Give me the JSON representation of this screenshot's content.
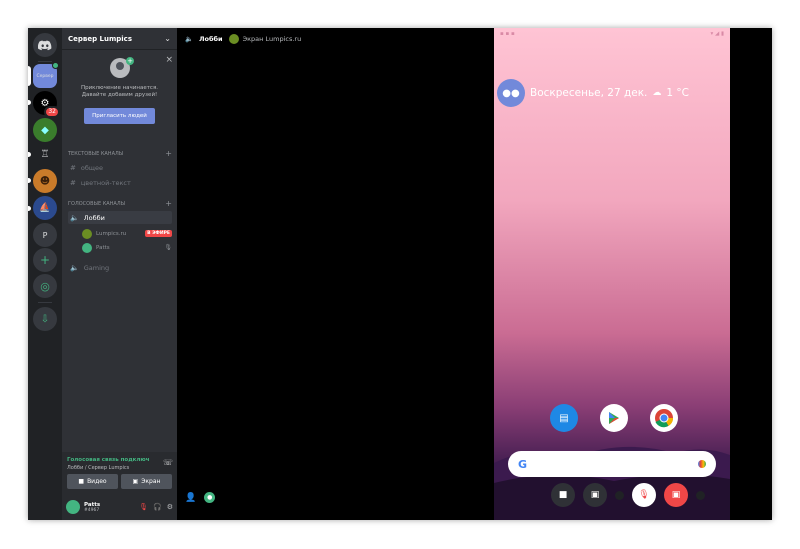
{
  "servers": {
    "active_label": "Сервер",
    "badge_count": "32",
    "letter_server": "P",
    "add_label": "+",
    "explore_label": "◎",
    "download_label": "⇩"
  },
  "server_header": {
    "name": "Сервер Lumpics",
    "chevron": "⌄"
  },
  "invite": {
    "close": "×",
    "line1": "Приключение начинается.",
    "line2": "Давайте добавим друзей!",
    "button": "Пригласить людей"
  },
  "text_category": {
    "label": "Текстовые каналы",
    "add": "+"
  },
  "text_channels": [
    {
      "name": "общее"
    },
    {
      "name": "цветной-текст"
    }
  ],
  "voice_category": {
    "label": "Голосовые каналы",
    "add": "+"
  },
  "voice_channels": {
    "lobby": "Лобби",
    "gaming": "Gaming"
  },
  "voice_users": [
    {
      "name": "Lumpics.ru",
      "live": "В ЭФИРЕ"
    },
    {
      "name": "Patts"
    }
  ],
  "voice_status": {
    "status": "Голосовая связь подключ",
    "location": "Лобби / Сервер Lumpics",
    "video_button": "Видео",
    "screen_button": "Экран"
  },
  "user_panel": {
    "name": "Patts",
    "tag": "#4967"
  },
  "topbar": {
    "channel": "Лобби",
    "screen_label": "Экран Lumpics.ru"
  },
  "phone": {
    "date_text": "Воскресенье, 27 дек.",
    "weather": "1 °C",
    "google_letter": "G"
  },
  "colors": {
    "blurple": "#7289da",
    "green": "#43b581",
    "red": "#f04747",
    "rail": "#202225",
    "sidebar": "#2f3136"
  }
}
